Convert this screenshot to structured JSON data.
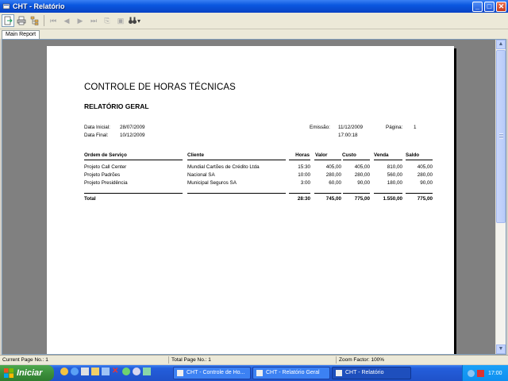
{
  "window": {
    "title": "CHT - Relatório"
  },
  "tabs": [
    {
      "label": "Main Report"
    }
  ],
  "report": {
    "title": "CONTROLE DE HORAS TÉCNICAS",
    "subtitle": "RELATÓRIO GERAL",
    "meta": {
      "data_inicial_label": "Data Inicial:",
      "data_inicial": "28/07/2009",
      "data_final_label": "Data Final:",
      "data_final": "10/12/2009",
      "emissao_label": "Emissão:",
      "emissao_date": "11/12/2009",
      "emissao_time": "17:00:18",
      "pagina_label": "Página:",
      "pagina": "1"
    },
    "columns": [
      "Ordem de Serviço",
      "Cliente",
      "Horas",
      "Valor",
      "Custo",
      "Venda",
      "Saldo"
    ],
    "rows": [
      [
        "Projeto Call Center",
        "Mundial Cartões de Crédito Ltda",
        "15:30",
        "405,00",
        "405,00",
        "810,00",
        "405,00"
      ],
      [
        "Projeto Padrões",
        "Nacional SA",
        "10:00",
        "280,00",
        "280,00",
        "560,00",
        "280,00"
      ],
      [
        "Projeto Presidência",
        "Municipal Seguros SA",
        "3:00",
        "60,00",
        "90,00",
        "180,00",
        "90,00"
      ]
    ],
    "total": {
      "label": "Total",
      "horas": "28:30",
      "valor": "745,00",
      "custo": "775,00",
      "venda": "1.550,00",
      "saldo": "775,00"
    }
  },
  "statusbar": {
    "current_page": "Current Page No.: 1",
    "total_page": "Total Page No.: 1",
    "zoom": "Zoom Factor: 100%"
  },
  "taskbar": {
    "start_label": "Iniciar",
    "items": [
      {
        "label": "CHT - Controle de Ho..."
      },
      {
        "label": "CHT - Relatório Geral"
      },
      {
        "label": "CHT - Relatório"
      }
    ],
    "clock": "17:00"
  },
  "colors": {
    "titlebar": "#0a57e0",
    "taskbar": "#245edb",
    "start": "#3c8f3c",
    "tray": "#0f8ff0"
  }
}
